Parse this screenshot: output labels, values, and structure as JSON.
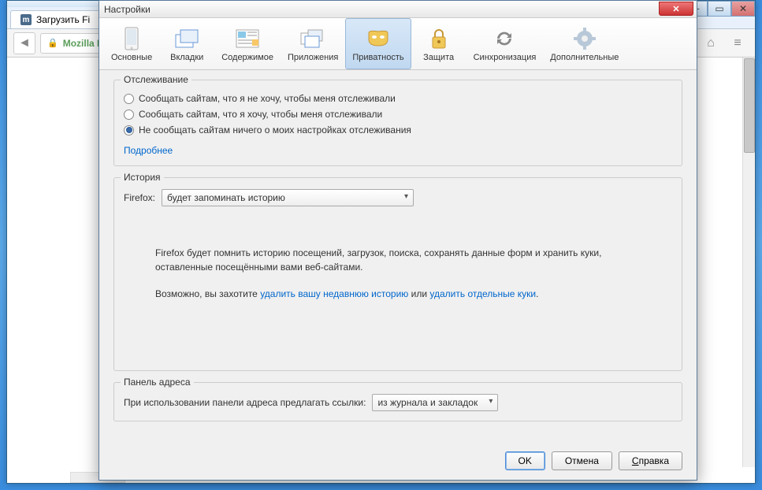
{
  "browser": {
    "tab_title": "Загрузить Fi",
    "url_host": "Mozilla Fo"
  },
  "dialog": {
    "title": "Настройки",
    "tabs": [
      {
        "label": "Основные"
      },
      {
        "label": "Вкладки"
      },
      {
        "label": "Содержимое"
      },
      {
        "label": "Приложения"
      },
      {
        "label": "Приватность"
      },
      {
        "label": "Защита"
      },
      {
        "label": "Синхронизация"
      },
      {
        "label": "Дополнительные"
      }
    ],
    "tracking": {
      "legend": "Отслеживание",
      "opt1": "Сообщать сайтам, что я не хочу, чтобы меня отслеживали",
      "opt2": "Сообщать сайтам, что я хочу, чтобы меня отслеживали",
      "opt3": "Не сообщать сайтам ничего о моих настройках отслеживания",
      "more": "Подробнее"
    },
    "history": {
      "legend": "История",
      "firefox_label": "Firefox:",
      "mode_selected": "будет запоминать историю",
      "para1": "Firefox будет помнить историю посещений, загрузок, поиска, сохранять данные форм и хранить куки, оставленные посещёнными вами веб-сайтами.",
      "para2_prefix": "Возможно, вы захотите ",
      "para2_link1": "удалить вашу недавнюю историю",
      "para2_mid": " или ",
      "para2_link2": "удалить отдельные куки",
      "para2_suffix": "."
    },
    "addressbar": {
      "legend": "Панель адреса",
      "label": "При использовании панели адреса предлагать ссылки:",
      "selected": "из журнала и закладок"
    },
    "buttons": {
      "ok": "OK",
      "cancel": "Отмена",
      "help": "Справка"
    }
  }
}
